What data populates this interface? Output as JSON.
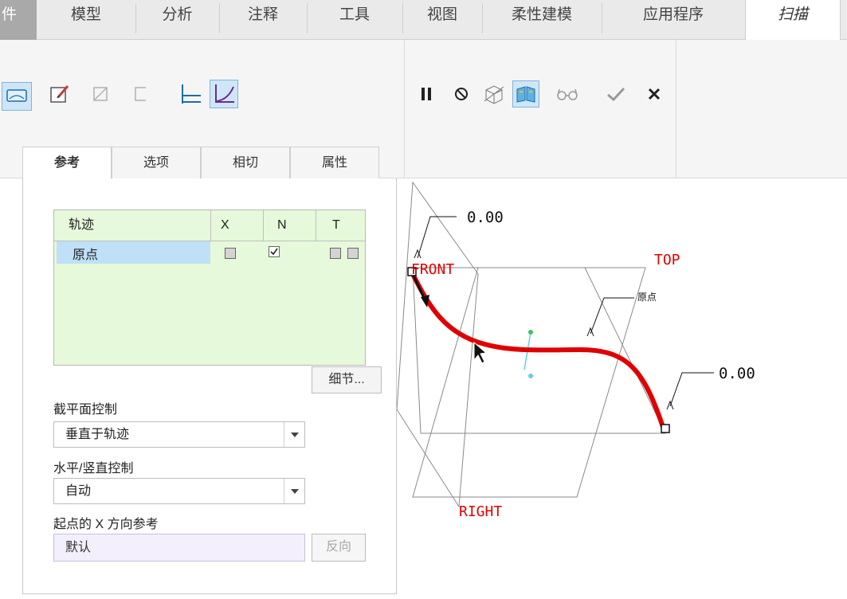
{
  "ribbon_tabs": [
    "件",
    "模型",
    "分析",
    "注释",
    "工具",
    "视图",
    "柔性建模",
    "应用程序",
    "扫描"
  ],
  "sub_tabs": [
    "参考",
    "选项",
    "相切",
    "属性"
  ],
  "trajectory_table": {
    "headers": [
      "轨迹",
      "X",
      "N",
      "T"
    ],
    "row_name": "原点",
    "x_checked": false,
    "n_checked": true,
    "t_checked": false
  },
  "details_button": "细节...",
  "section_plane_control": {
    "label": "截平面控制",
    "value": "垂直于轨迹"
  },
  "hv_control": {
    "label": "水平/竖直控制",
    "value": "自动"
  },
  "start_x_ref": {
    "label": "起点的 X 方向参考",
    "value": "默认",
    "flip_button": "反向"
  },
  "viewport": {
    "dim_top": "0.00",
    "dim_right": "0.00",
    "plane_front": "FRONT",
    "plane_top": "TOP",
    "plane_right": "RIGHT",
    "origin_label": "原点",
    "trajectory_color": "#e00000",
    "plane_label_color": "#e00000"
  }
}
